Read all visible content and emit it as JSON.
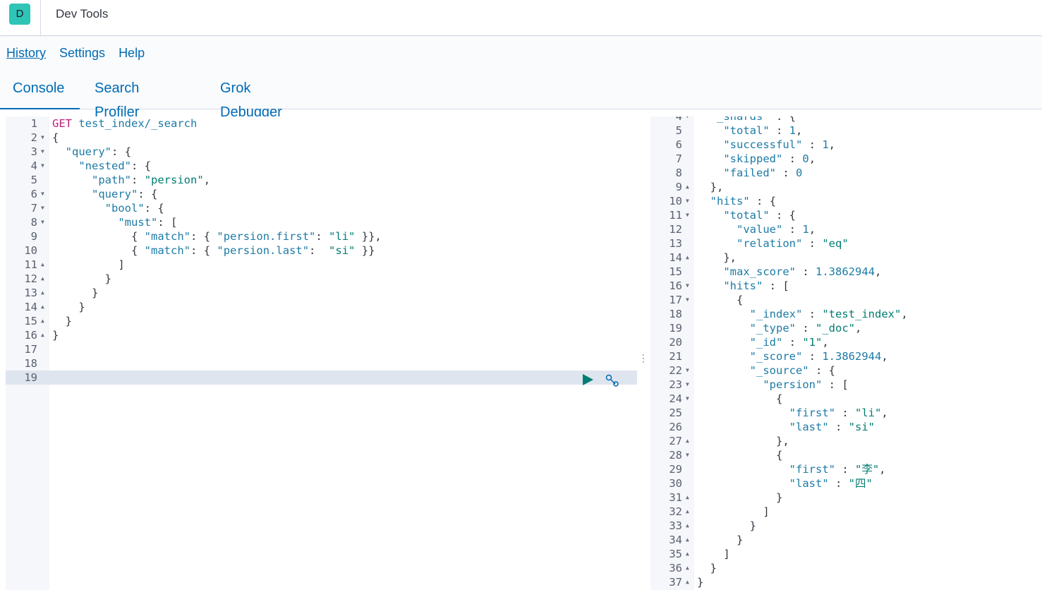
{
  "header": {
    "avatar_letter": "D",
    "title": "Dev Tools"
  },
  "top_links": [
    {
      "label": "History"
    },
    {
      "label": "Settings"
    },
    {
      "label": "Help"
    }
  ],
  "tabs": [
    {
      "label": "Console"
    },
    {
      "label": "Search Profiler"
    },
    {
      "label": "Grok Debugger"
    }
  ],
  "request_editor": {
    "lines": [
      {
        "n": "1",
        "fold": ""
      },
      {
        "n": "2",
        "fold": "▼"
      },
      {
        "n": "3",
        "fold": "▼"
      },
      {
        "n": "4",
        "fold": "▼"
      },
      {
        "n": "5",
        "fold": ""
      },
      {
        "n": "6",
        "fold": "▼"
      },
      {
        "n": "7",
        "fold": "▼"
      },
      {
        "n": "8",
        "fold": "▼"
      },
      {
        "n": "9",
        "fold": ""
      },
      {
        "n": "10",
        "fold": ""
      },
      {
        "n": "11",
        "fold": "▲"
      },
      {
        "n": "12",
        "fold": "▲"
      },
      {
        "n": "13",
        "fold": "▲"
      },
      {
        "n": "14",
        "fold": "▲"
      },
      {
        "n": "15",
        "fold": "▲"
      },
      {
        "n": "16",
        "fold": "▲"
      },
      {
        "n": "17",
        "fold": ""
      },
      {
        "n": "18",
        "fold": ""
      },
      {
        "n": "19",
        "fold": ""
      }
    ],
    "method": "GET",
    "path": "test_index/_search",
    "code": [
      "",
      "{",
      "  \"query\": {",
      "    \"nested\": {",
      "      \"path\": \"persion\",",
      "      \"query\": {",
      "        \"bool\": {",
      "          \"must\": [",
      "            { \"match\": { \"persion.first\": \"li\" }},",
      "            { \"match\": { \"persion.last\":  \"si\" }}",
      "          ]",
      "        }",
      "      }",
      "    }",
      "  }",
      "}",
      "",
      "",
      ""
    ]
  },
  "response_editor": {
    "lines": [
      {
        "n": "4",
        "fold": "▼",
        "code": "  \"_shards\" : {"
      },
      {
        "n": "5",
        "fold": "",
        "code": "    \"total\" : 1,"
      },
      {
        "n": "6",
        "fold": "",
        "code": "    \"successful\" : 1,"
      },
      {
        "n": "7",
        "fold": "",
        "code": "    \"skipped\" : 0,"
      },
      {
        "n": "8",
        "fold": "",
        "code": "    \"failed\" : 0"
      },
      {
        "n": "9",
        "fold": "▲",
        "code": "  },"
      },
      {
        "n": "10",
        "fold": "▼",
        "code": "  \"hits\" : {"
      },
      {
        "n": "11",
        "fold": "▼",
        "code": "    \"total\" : {"
      },
      {
        "n": "12",
        "fold": "",
        "code": "      \"value\" : 1,"
      },
      {
        "n": "13",
        "fold": "",
        "code": "      \"relation\" : \"eq\""
      },
      {
        "n": "14",
        "fold": "▲",
        "code": "    },"
      },
      {
        "n": "15",
        "fold": "",
        "code": "    \"max_score\" : 1.3862944,"
      },
      {
        "n": "16",
        "fold": "▼",
        "code": "    \"hits\" : ["
      },
      {
        "n": "17",
        "fold": "▼",
        "code": "      {"
      },
      {
        "n": "18",
        "fold": "",
        "code": "        \"_index\" : \"test_index\","
      },
      {
        "n": "19",
        "fold": "",
        "code": "        \"_type\" : \"_doc\","
      },
      {
        "n": "20",
        "fold": "",
        "code": "        \"_id\" : \"1\","
      },
      {
        "n": "21",
        "fold": "",
        "code": "        \"_score\" : 1.3862944,"
      },
      {
        "n": "22",
        "fold": "▼",
        "code": "        \"_source\" : {"
      },
      {
        "n": "23",
        "fold": "▼",
        "code": "          \"persion\" : ["
      },
      {
        "n": "24",
        "fold": "▼",
        "code": "            {"
      },
      {
        "n": "25",
        "fold": "",
        "code": "              \"first\" : \"li\","
      },
      {
        "n": "26",
        "fold": "",
        "code": "              \"last\" : \"si\""
      },
      {
        "n": "27",
        "fold": "▲",
        "code": "            },"
      },
      {
        "n": "28",
        "fold": "▼",
        "code": "            {"
      },
      {
        "n": "29",
        "fold": "",
        "code": "              \"first\" : \"李\","
      },
      {
        "n": "30",
        "fold": "",
        "code": "              \"last\" : \"四\""
      },
      {
        "n": "31",
        "fold": "▲",
        "code": "            }"
      },
      {
        "n": "32",
        "fold": "▲",
        "code": "          ]"
      },
      {
        "n": "33",
        "fold": "▲",
        "code": "        }"
      },
      {
        "n": "34",
        "fold": "▲",
        "code": "      }"
      },
      {
        "n": "35",
        "fold": "▲",
        "code": "    ]"
      },
      {
        "n": "36",
        "fold": "▲",
        "code": "  }"
      },
      {
        "n": "37",
        "fold": "▲",
        "code": "}"
      }
    ]
  },
  "icons": {
    "run": "play-icon",
    "wrench": "wrench-icon",
    "splitter": "drag-handle-icon"
  },
  "colors": {
    "accent": "#006bb4",
    "string": "#017d73",
    "key": "#1d7ba6",
    "method": "#bc1e7b"
  }
}
